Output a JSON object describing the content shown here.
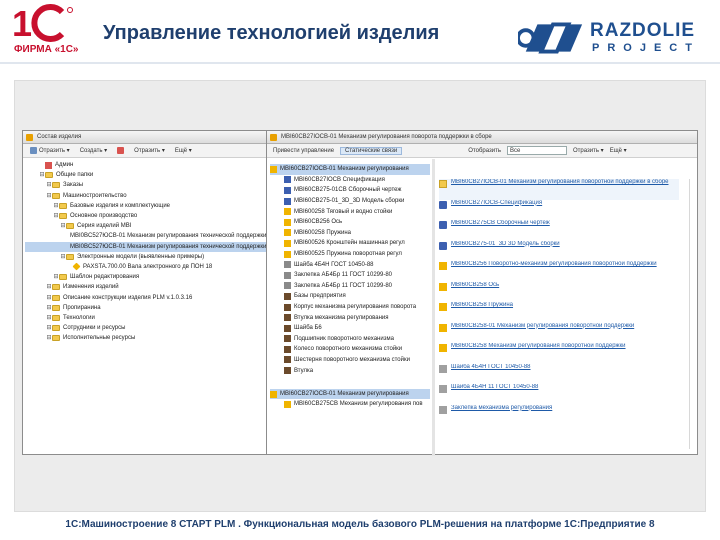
{
  "header": {
    "firm": "ФИРМА «1С»",
    "title": "Управление технологией изделия",
    "partner_word1": "RAZDOLIE",
    "partner_word2": "PROJECT"
  },
  "colors": {
    "title": "#1f3f6e",
    "logo_red": "#c8102e",
    "selection": "#bcd3ee"
  },
  "left_window": {
    "title": "Состав изделия",
    "toolbar": [
      "Отразить ▾",
      "Создать ▾",
      "Отразить ▾",
      "Ещё ▾"
    ],
    "tree": [
      "Админ",
      "Общие папки",
      "Заказы",
      "Машиностроительство",
      "Базовые изделия и комплектующие",
      "Основное производство",
      "Серия изделий MBI",
      "MBI0BC527ЮCB-01 Механизм регулирования технической поддержки",
      "MBI0BC527ЮCB-01 Механизм регулирования технической поддержки",
      "Электронные модели (выявленные примеры)",
      "PAXSTA.700.00 Вала электронного дв ПОН 18",
      "Шаблон редактирования",
      "Изменения изделий",
      "Описание конструкции изделия PLM v.1.0.3.16",
      "Пропиранина",
      "Технологии",
      "Сотрудники и ресурсы",
      "Исполнительные ресурсы"
    ]
  },
  "right_window": {
    "title": "MBI60CB27IOCB-01 Механизм регулирования поворота поддержки в сборе",
    "tabs": [
      "Привести управление",
      "Статические связи"
    ],
    "filter_label": "Отобразить",
    "filter_value": "Все",
    "right_tb": [
      "Отразить ▾",
      "Ещё ▾"
    ],
    "tree_upper": [
      "MBI60CB27IOCB-01 Механизм регулирования",
      "MBI60CB27IOCB Спецификация",
      "MBI60CB275-01CB Сборочный чертеж",
      "MBI60CB275-01_3D_3D Модель сборки",
      "MBI600258 Тяговый и водно стойки",
      "MBI60CB256 Ось",
      "MBI600258 Пружина",
      "MBI600526 Кронштейн машинная регул",
      "MBI600525 Пружина поворотная регул",
      "Шайба 4Б4Н ГОСТ 10450-88",
      "Заклепка АБ4Бр 11 ГОСТ 10299-80",
      "Заклепка АБ4Бр 11 ГОСТ 10299-80",
      "Базы предприятия",
      "Корпус механизма регулирования поворота",
      "Втулка механизма регулирования",
      "Шайба Б6",
      "Подшипник поворотного механизма",
      "Колесо поворотного механизма стойки",
      "Шестерня поворотного механизма стойки",
      "Втулка"
    ],
    "tree_lower": [
      "MBI60CB27IOCB-01 Механизм регулирования",
      "MBI60CB275CB Механизм регулирования пов"
    ],
    "list": [
      "MBI60CB27IOCB-01 Механизм регулирования поворотной поддержки в сборе",
      "MBI60CB27IOCB-Спецификация",
      "MBI60CB275CB Сборочный чертеж",
      "MBI60CB275-01_3D 3D Модель сборки",
      "MBI60CB256 Поворотно-механизм регулирования поворотной поддержки",
      "MBI60CB258 Ось",
      "MBI60CB258 Пружина",
      "MBI60CB258-01 Механизм регулирования поворотной поддержки",
      "MBI60CB258 Механизм регулирования поворотной поддержки",
      "Шайба 4Б4Н ГОСТ 10450-88",
      "Шайба 4Б4Н 11 ГОСТ 10450-88",
      "Заклепка механизма регулирования"
    ]
  },
  "footer": "1С:Машиностроение 8 СТАРТ PLM . Функциональная модель базового PLM-решения на платформе 1С:Предприятие 8"
}
